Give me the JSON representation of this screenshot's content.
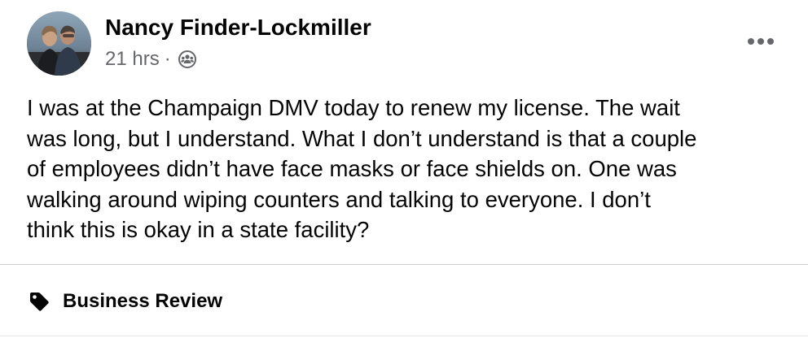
{
  "post": {
    "author_name": "Nancy Finder-Lockmiller",
    "timestamp": "21 hrs",
    "separator": "·",
    "audience_icon": "group-audience-icon",
    "more_icon": "more-options-icon",
    "body_lines": [
      "I was at the Champaign DMV today to renew my license.  The wait",
      "was long, but I understand.  What I don’t understand is that a couple",
      "of employees didn’t have face masks or face shields on.  One was",
      "walking around wiping counters and talking to everyone.  I don’t",
      "think this is okay in a state facility?"
    ]
  },
  "footer": {
    "tag_icon": "tag-icon",
    "tag_label": "Business Review"
  },
  "colors": {
    "text_primary": "#050505",
    "text_secondary": "#65676b",
    "divider": "#ced0d4"
  }
}
